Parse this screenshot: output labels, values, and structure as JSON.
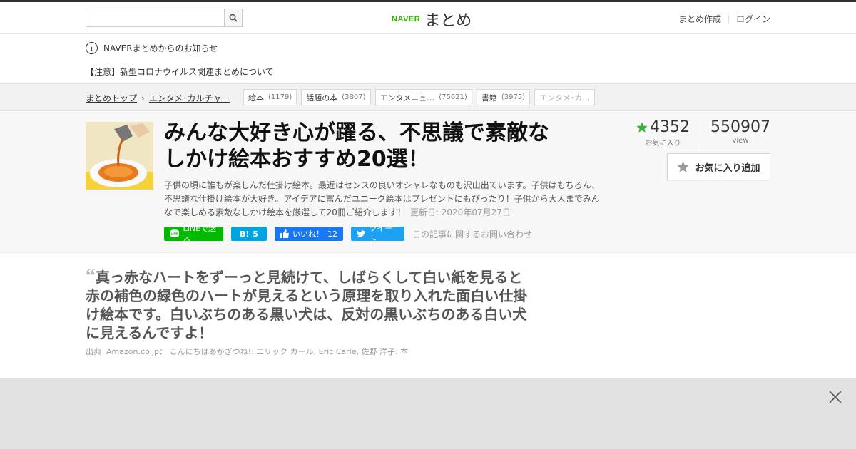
{
  "header": {
    "search_placeholder": "",
    "logo_brand": "NAVER",
    "logo_text": "まとめ",
    "links": [
      "まとめ作成",
      "ログイン"
    ]
  },
  "notice": {
    "title": "NAVERまとめからのお知らせ",
    "item": "【注意】新型コロナウイルス関連まとめについて"
  },
  "breadcrumb": {
    "items": [
      "まとめトップ",
      "エンタメ･カルチャー"
    ]
  },
  "tags": [
    {
      "label": "絵本",
      "count": "(1179)"
    },
    {
      "label": "話題の本",
      "count": "(3807)"
    },
    {
      "label": "エンタメニュ…",
      "count": "(75621)"
    },
    {
      "label": "書籍",
      "count": "(3975)"
    },
    {
      "label": "エンタメ･カ…",
      "count": ""
    }
  ],
  "article": {
    "title_line1": "みんな大好き心が躍る、不思議で素敵な",
    "title_line2": "しかけ絵本おすすめ20選！",
    "description": "子供の頃に誰もが楽しんだ仕掛け絵本。最近はセンスの良いオシャレなものも沢山出ています。子供はもちろん、不思議な仕掛け絵本が大好き。アイデアに富んだユニーク絵本はプレゼントにもぴったり！子供から大人までみんなで楽しめる素敵なしかけ絵本を厳選して20冊ご紹介します！",
    "updated": "更新日: 2020年07月27日",
    "favorites": "4352",
    "favorites_label": "お気に入り",
    "views": "550907",
    "views_label": "view",
    "fav_button": "お気に入り追加"
  },
  "share": {
    "line": "LINEで送る",
    "hatena_count": "5",
    "fb_label": "いいね！",
    "fb_count": "12",
    "tweet": "ツイート",
    "contact": "この記事に関するお問い合わせ"
  },
  "quote": {
    "mark": "“",
    "text": "真っ赤なハートをずーっと見続けて、しばらくして白い紙を見ると赤の補色の緑色のハートが見えるという原理を取り入れた面白い仕掛け絵本です。白いぶちのある黒い犬は、反対の黒いぶちのある白い犬に見えるんですよ！",
    "source_label": "出典",
    "source": "Amazon.co.jp： こんにちはあかぎつね!: エリック カール, Eric Carle, 佐野 洋子: 本"
  },
  "colors": {
    "naver_green": "#2db400",
    "line_green": "#00b900",
    "hatena_blue": "#00a4de",
    "fb_blue": "#1877f2",
    "twitter_blue": "#1da1f2",
    "star_green": "#3cb043"
  }
}
